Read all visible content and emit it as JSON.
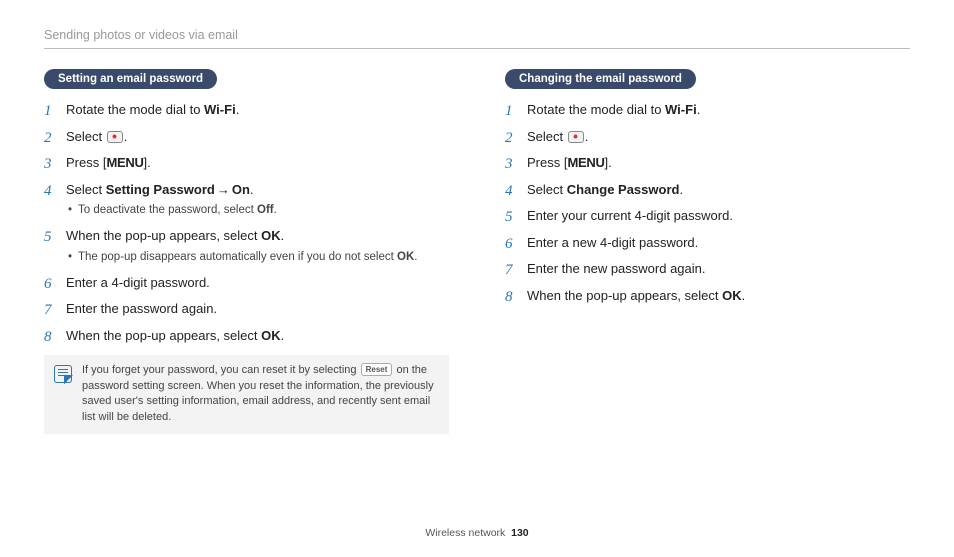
{
  "header": "Sending photos or videos via email",
  "left": {
    "pill": "Setting an email password",
    "step1a": "Rotate the mode dial to ",
    "step1b": ".",
    "step2a": "Select ",
    "step2b": ".",
    "step3a": "Press [",
    "step3c": "].",
    "step4a": "Select ",
    "step4b": "Setting Password",
    "step4c": "On",
    "step4d": ".",
    "step4sub1a": "To deactivate the password, select ",
    "step4sub1b": "Off",
    "step4sub1c": ".",
    "step5a": " When the pop-up appears, select ",
    "step5b": "OK",
    "step5c": ".",
    "step5sub1a": "The pop-up disappears automatically even if you do not select ",
    "step5sub1b": "OK",
    "step5sub1c": ".",
    "step6": "Enter a 4-digit password.",
    "step7": "Enter the password again.",
    "step8a": "When the pop-up appears, select ",
    "step8b": "OK",
    "step8c": ".",
    "note1": "If you forget your password, you can reset it by selecting ",
    "noteReset": "Reset",
    "note2": " on the password setting screen. When you reset the information, the previously saved user's setting information, email address, and recently sent email list will be deleted."
  },
  "right": {
    "pill": "Changing the email password",
    "step1a": "Rotate the mode dial to ",
    "step1b": ".",
    "step2a": "Select ",
    "step2b": ".",
    "step3a": "Press [",
    "step3c": "].",
    "step4a": "Select ",
    "step4b": "Change Password",
    "step4c": ".",
    "step5": "Enter your current 4-digit password.",
    "step6": "Enter a new 4-digit password.",
    "step7": "Enter the new password again.",
    "step8a": "When the pop-up appears, select ",
    "step8b": "OK",
    "step8c": "."
  },
  "glyphs": {
    "wifi": "Wi-Fi",
    "menu": "MENU",
    "arrow": "→"
  },
  "footer": {
    "section": "Wireless network",
    "page": "130"
  }
}
